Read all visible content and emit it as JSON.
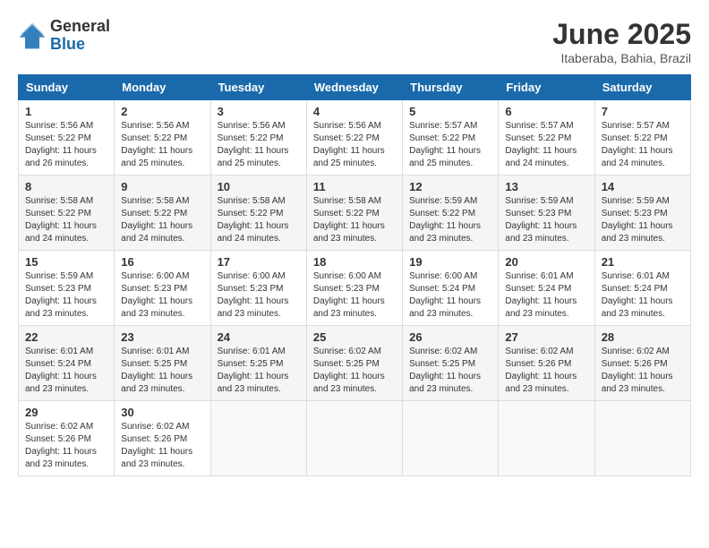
{
  "header": {
    "logo_general": "General",
    "logo_blue": "Blue",
    "month_title": "June 2025",
    "subtitle": "Itaberaba, Bahia, Brazil"
  },
  "days_of_week": [
    "Sunday",
    "Monday",
    "Tuesday",
    "Wednesday",
    "Thursday",
    "Friday",
    "Saturday"
  ],
  "weeks": [
    [
      {
        "day": "1",
        "sunrise": "5:56 AM",
        "sunset": "5:22 PM",
        "daylight": "11 hours and 26 minutes."
      },
      {
        "day": "2",
        "sunrise": "5:56 AM",
        "sunset": "5:22 PM",
        "daylight": "11 hours and 25 minutes."
      },
      {
        "day": "3",
        "sunrise": "5:56 AM",
        "sunset": "5:22 PM",
        "daylight": "11 hours and 25 minutes."
      },
      {
        "day": "4",
        "sunrise": "5:56 AM",
        "sunset": "5:22 PM",
        "daylight": "11 hours and 25 minutes."
      },
      {
        "day": "5",
        "sunrise": "5:57 AM",
        "sunset": "5:22 PM",
        "daylight": "11 hours and 25 minutes."
      },
      {
        "day": "6",
        "sunrise": "5:57 AM",
        "sunset": "5:22 PM",
        "daylight": "11 hours and 24 minutes."
      },
      {
        "day": "7",
        "sunrise": "5:57 AM",
        "sunset": "5:22 PM",
        "daylight": "11 hours and 24 minutes."
      }
    ],
    [
      {
        "day": "8",
        "sunrise": "5:58 AM",
        "sunset": "5:22 PM",
        "daylight": "11 hours and 24 minutes."
      },
      {
        "day": "9",
        "sunrise": "5:58 AM",
        "sunset": "5:22 PM",
        "daylight": "11 hours and 24 minutes."
      },
      {
        "day": "10",
        "sunrise": "5:58 AM",
        "sunset": "5:22 PM",
        "daylight": "11 hours and 24 minutes."
      },
      {
        "day": "11",
        "sunrise": "5:58 AM",
        "sunset": "5:22 PM",
        "daylight": "11 hours and 23 minutes."
      },
      {
        "day": "12",
        "sunrise": "5:59 AM",
        "sunset": "5:22 PM",
        "daylight": "11 hours and 23 minutes."
      },
      {
        "day": "13",
        "sunrise": "5:59 AM",
        "sunset": "5:23 PM",
        "daylight": "11 hours and 23 minutes."
      },
      {
        "day": "14",
        "sunrise": "5:59 AM",
        "sunset": "5:23 PM",
        "daylight": "11 hours and 23 minutes."
      }
    ],
    [
      {
        "day": "15",
        "sunrise": "5:59 AM",
        "sunset": "5:23 PM",
        "daylight": "11 hours and 23 minutes."
      },
      {
        "day": "16",
        "sunrise": "6:00 AM",
        "sunset": "5:23 PM",
        "daylight": "11 hours and 23 minutes."
      },
      {
        "day": "17",
        "sunrise": "6:00 AM",
        "sunset": "5:23 PM",
        "daylight": "11 hours and 23 minutes."
      },
      {
        "day": "18",
        "sunrise": "6:00 AM",
        "sunset": "5:23 PM",
        "daylight": "11 hours and 23 minutes."
      },
      {
        "day": "19",
        "sunrise": "6:00 AM",
        "sunset": "5:24 PM",
        "daylight": "11 hours and 23 minutes."
      },
      {
        "day": "20",
        "sunrise": "6:01 AM",
        "sunset": "5:24 PM",
        "daylight": "11 hours and 23 minutes."
      },
      {
        "day": "21",
        "sunrise": "6:01 AM",
        "sunset": "5:24 PM",
        "daylight": "11 hours and 23 minutes."
      }
    ],
    [
      {
        "day": "22",
        "sunrise": "6:01 AM",
        "sunset": "5:24 PM",
        "daylight": "11 hours and 23 minutes."
      },
      {
        "day": "23",
        "sunrise": "6:01 AM",
        "sunset": "5:25 PM",
        "daylight": "11 hours and 23 minutes."
      },
      {
        "day": "24",
        "sunrise": "6:01 AM",
        "sunset": "5:25 PM",
        "daylight": "11 hours and 23 minutes."
      },
      {
        "day": "25",
        "sunrise": "6:02 AM",
        "sunset": "5:25 PM",
        "daylight": "11 hours and 23 minutes."
      },
      {
        "day": "26",
        "sunrise": "6:02 AM",
        "sunset": "5:25 PM",
        "daylight": "11 hours and 23 minutes."
      },
      {
        "day": "27",
        "sunrise": "6:02 AM",
        "sunset": "5:26 PM",
        "daylight": "11 hours and 23 minutes."
      },
      {
        "day": "28",
        "sunrise": "6:02 AM",
        "sunset": "5:26 PM",
        "daylight": "11 hours and 23 minutes."
      }
    ],
    [
      {
        "day": "29",
        "sunrise": "6:02 AM",
        "sunset": "5:26 PM",
        "daylight": "11 hours and 23 minutes."
      },
      {
        "day": "30",
        "sunrise": "6:02 AM",
        "sunset": "5:26 PM",
        "daylight": "11 hours and 23 minutes."
      },
      null,
      null,
      null,
      null,
      null
    ]
  ],
  "labels": {
    "sunrise": "Sunrise:",
    "sunset": "Sunset:",
    "daylight": "Daylight:"
  }
}
